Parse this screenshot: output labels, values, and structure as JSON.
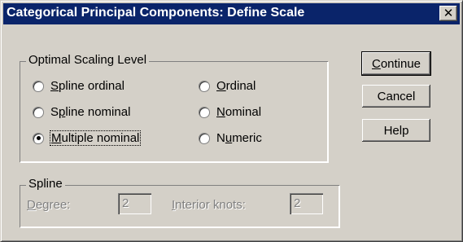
{
  "window": {
    "title": "Categorical Principal Components: Define Scale",
    "close_glyph": "✕"
  },
  "scaling_group": {
    "label": "Optimal Scaling Level",
    "options": [
      {
        "pre": "",
        "mn": "S",
        "post": "pline ordinal",
        "selected": false
      },
      {
        "pre": "S",
        "mn": "p",
        "post": "line nominal",
        "selected": false
      },
      {
        "pre": "",
        "mn": "M",
        "post": "ultiple nominal",
        "selected": true
      },
      {
        "pre": "",
        "mn": "O",
        "post": "rdinal",
        "selected": false
      },
      {
        "pre": "",
        "mn": "N",
        "post": "ominal",
        "selected": false
      },
      {
        "pre": "N",
        "mn": "u",
        "post": "meric",
        "selected": false
      }
    ]
  },
  "spline_group": {
    "label": "Spline",
    "degree": {
      "mn": "D",
      "post": "egree:",
      "value": "2"
    },
    "knots": {
      "mn": "I",
      "post": "nterior knots:",
      "value": "2"
    }
  },
  "buttons": {
    "continue": {
      "mn": "C",
      "post": "ontinue"
    },
    "cancel": "Cancel",
    "help": "Help"
  }
}
